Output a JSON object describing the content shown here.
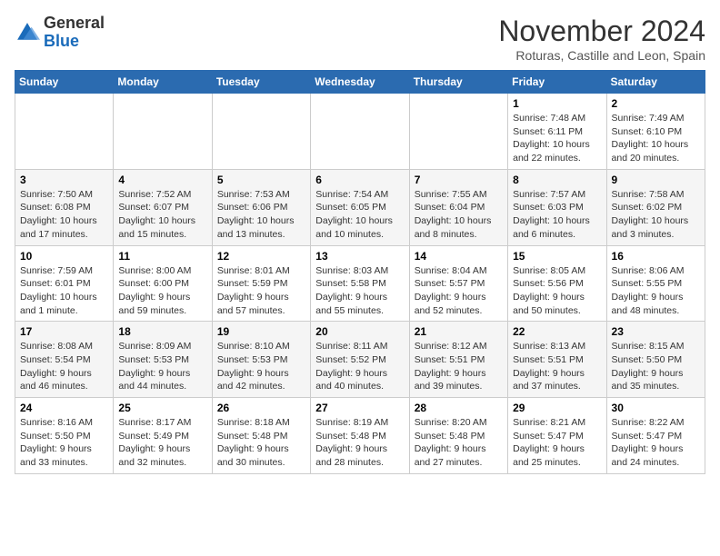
{
  "logo": {
    "general": "General",
    "blue": "Blue"
  },
  "title": "November 2024",
  "location": "Roturas, Castille and Leon, Spain",
  "days_of_week": [
    "Sunday",
    "Monday",
    "Tuesday",
    "Wednesday",
    "Thursday",
    "Friday",
    "Saturday"
  ],
  "weeks": [
    [
      {
        "day": "",
        "info": ""
      },
      {
        "day": "",
        "info": ""
      },
      {
        "day": "",
        "info": ""
      },
      {
        "day": "",
        "info": ""
      },
      {
        "day": "",
        "info": ""
      },
      {
        "day": "1",
        "info": "Sunrise: 7:48 AM\nSunset: 6:11 PM\nDaylight: 10 hours and 22 minutes."
      },
      {
        "day": "2",
        "info": "Sunrise: 7:49 AM\nSunset: 6:10 PM\nDaylight: 10 hours and 20 minutes."
      }
    ],
    [
      {
        "day": "3",
        "info": "Sunrise: 7:50 AM\nSunset: 6:08 PM\nDaylight: 10 hours and 17 minutes."
      },
      {
        "day": "4",
        "info": "Sunrise: 7:52 AM\nSunset: 6:07 PM\nDaylight: 10 hours and 15 minutes."
      },
      {
        "day": "5",
        "info": "Sunrise: 7:53 AM\nSunset: 6:06 PM\nDaylight: 10 hours and 13 minutes."
      },
      {
        "day": "6",
        "info": "Sunrise: 7:54 AM\nSunset: 6:05 PM\nDaylight: 10 hours and 10 minutes."
      },
      {
        "day": "7",
        "info": "Sunrise: 7:55 AM\nSunset: 6:04 PM\nDaylight: 10 hours and 8 minutes."
      },
      {
        "day": "8",
        "info": "Sunrise: 7:57 AM\nSunset: 6:03 PM\nDaylight: 10 hours and 6 minutes."
      },
      {
        "day": "9",
        "info": "Sunrise: 7:58 AM\nSunset: 6:02 PM\nDaylight: 10 hours and 3 minutes."
      }
    ],
    [
      {
        "day": "10",
        "info": "Sunrise: 7:59 AM\nSunset: 6:01 PM\nDaylight: 10 hours and 1 minute."
      },
      {
        "day": "11",
        "info": "Sunrise: 8:00 AM\nSunset: 6:00 PM\nDaylight: 9 hours and 59 minutes."
      },
      {
        "day": "12",
        "info": "Sunrise: 8:01 AM\nSunset: 5:59 PM\nDaylight: 9 hours and 57 minutes."
      },
      {
        "day": "13",
        "info": "Sunrise: 8:03 AM\nSunset: 5:58 PM\nDaylight: 9 hours and 55 minutes."
      },
      {
        "day": "14",
        "info": "Sunrise: 8:04 AM\nSunset: 5:57 PM\nDaylight: 9 hours and 52 minutes."
      },
      {
        "day": "15",
        "info": "Sunrise: 8:05 AM\nSunset: 5:56 PM\nDaylight: 9 hours and 50 minutes."
      },
      {
        "day": "16",
        "info": "Sunrise: 8:06 AM\nSunset: 5:55 PM\nDaylight: 9 hours and 48 minutes."
      }
    ],
    [
      {
        "day": "17",
        "info": "Sunrise: 8:08 AM\nSunset: 5:54 PM\nDaylight: 9 hours and 46 minutes."
      },
      {
        "day": "18",
        "info": "Sunrise: 8:09 AM\nSunset: 5:53 PM\nDaylight: 9 hours and 44 minutes."
      },
      {
        "day": "19",
        "info": "Sunrise: 8:10 AM\nSunset: 5:53 PM\nDaylight: 9 hours and 42 minutes."
      },
      {
        "day": "20",
        "info": "Sunrise: 8:11 AM\nSunset: 5:52 PM\nDaylight: 9 hours and 40 minutes."
      },
      {
        "day": "21",
        "info": "Sunrise: 8:12 AM\nSunset: 5:51 PM\nDaylight: 9 hours and 39 minutes."
      },
      {
        "day": "22",
        "info": "Sunrise: 8:13 AM\nSunset: 5:51 PM\nDaylight: 9 hours and 37 minutes."
      },
      {
        "day": "23",
        "info": "Sunrise: 8:15 AM\nSunset: 5:50 PM\nDaylight: 9 hours and 35 minutes."
      }
    ],
    [
      {
        "day": "24",
        "info": "Sunrise: 8:16 AM\nSunset: 5:50 PM\nDaylight: 9 hours and 33 minutes."
      },
      {
        "day": "25",
        "info": "Sunrise: 8:17 AM\nSunset: 5:49 PM\nDaylight: 9 hours and 32 minutes."
      },
      {
        "day": "26",
        "info": "Sunrise: 8:18 AM\nSunset: 5:48 PM\nDaylight: 9 hours and 30 minutes."
      },
      {
        "day": "27",
        "info": "Sunrise: 8:19 AM\nSunset: 5:48 PM\nDaylight: 9 hours and 28 minutes."
      },
      {
        "day": "28",
        "info": "Sunrise: 8:20 AM\nSunset: 5:48 PM\nDaylight: 9 hours and 27 minutes."
      },
      {
        "day": "29",
        "info": "Sunrise: 8:21 AM\nSunset: 5:47 PM\nDaylight: 9 hours and 25 minutes."
      },
      {
        "day": "30",
        "info": "Sunrise: 8:22 AM\nSunset: 5:47 PM\nDaylight: 9 hours and 24 minutes."
      }
    ]
  ]
}
